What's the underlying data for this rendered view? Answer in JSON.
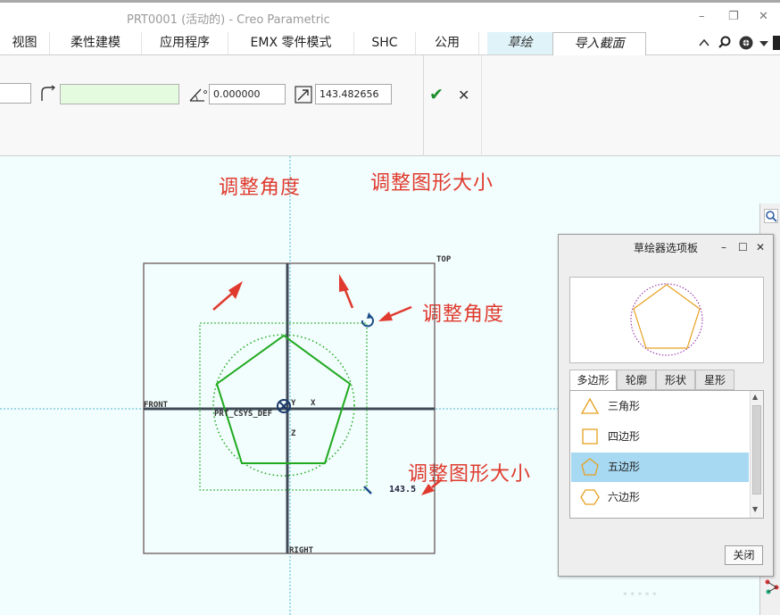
{
  "window": {
    "title": "PRT0001 (活动的) - Creo Parametric",
    "controls": [
      "–",
      "❐",
      "✕"
    ]
  },
  "tabs": [
    {
      "label": "视图"
    },
    {
      "label": "柔性建模"
    },
    {
      "label": "应用程序"
    },
    {
      "label": "EMX 零件模式"
    },
    {
      "label": "SHC"
    },
    {
      "label": "公用"
    },
    {
      "label": "草绘"
    },
    {
      "label": "导入截面"
    }
  ],
  "ribbon": {
    "angle_value": "0.000000",
    "scale_value": "143.482656"
  },
  "annotations": {
    "adjust_angle": "调整角度",
    "adjust_size": "调整图形大小"
  },
  "sketch": {
    "label_top": "TOP",
    "label_front": "FRONT",
    "label_right": "RIGHT",
    "label_csys": "PRT_CSYS_DEF",
    "label_y": "Y",
    "label_x": "X",
    "label_z": "Z",
    "dimension": "143.5"
  },
  "palette": {
    "title": "草绘器选项板",
    "tabs": [
      "多边形",
      "轮廓",
      "形状",
      "星形"
    ],
    "items": [
      {
        "label": "三角形",
        "shape": "triangle"
      },
      {
        "label": "四边形",
        "shape": "square"
      },
      {
        "label": "五边形",
        "shape": "pentagon",
        "selected": true
      },
      {
        "label": "六边形",
        "shape": "hexagon"
      }
    ],
    "close_label": "关闭"
  },
  "colors": {
    "accent_red": "#e03a2e",
    "sketch_green": "#1faa1f",
    "selection_blue": "#a8d9f2",
    "shape_orange": "#e6a020"
  }
}
